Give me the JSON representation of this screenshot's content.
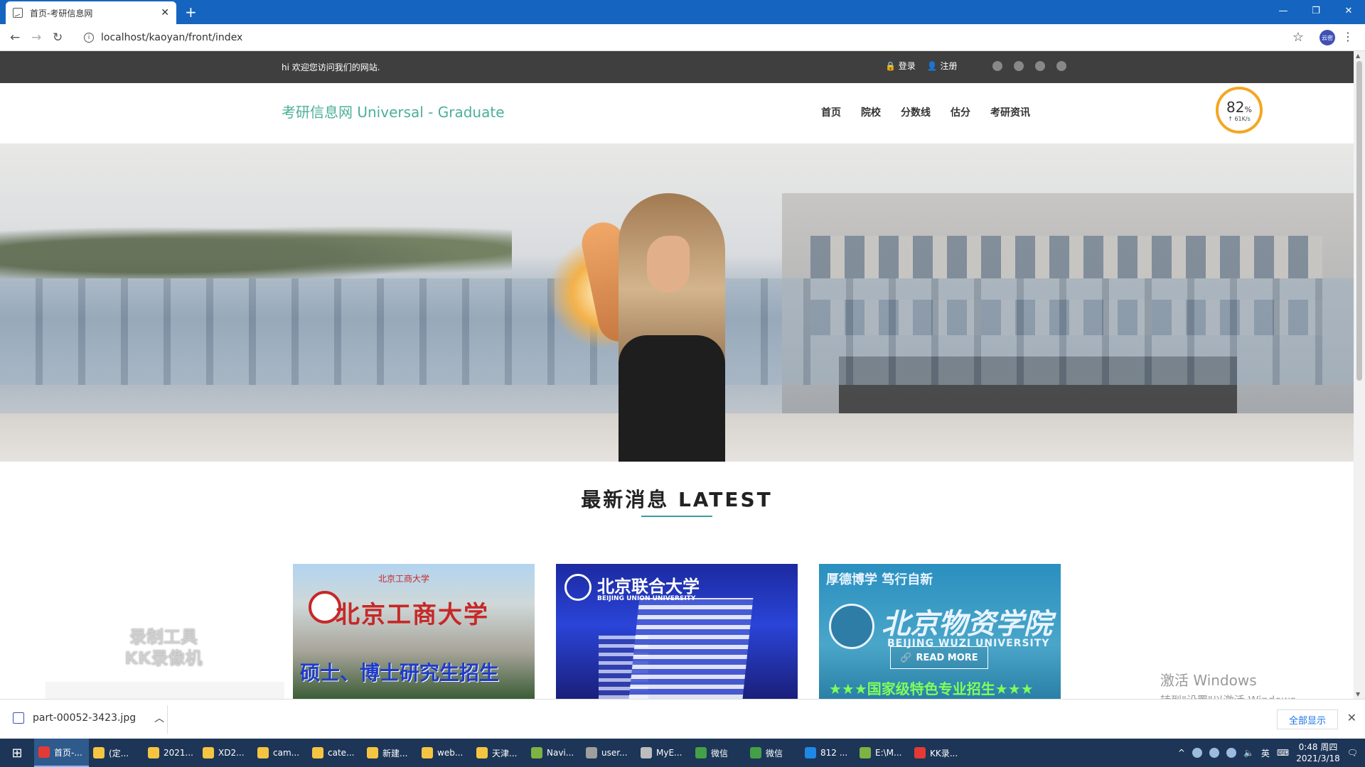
{
  "browser": {
    "tab_title": "首页-考研信息网",
    "url": "localhost/kaoyan/front/index",
    "profile_label": "云密"
  },
  "topbar": {
    "welcome": "hi 欢迎您访问我们的网站.",
    "login": "登录",
    "register": "注册"
  },
  "header": {
    "logo": "考研信息网 Universal - Graduate",
    "nav": [
      "首页",
      "院校",
      "分数线",
      "估分",
      "考研资讯"
    ]
  },
  "speed_widget": {
    "percent": "82",
    "unit": "%",
    "rate": "61K/s"
  },
  "section": {
    "title": "最新消息 LATEST"
  },
  "cards": [
    {
      "small_text": "北京工商大学",
      "name_cn": "北京工商大学",
      "caption": "硕士、博士研究生招生"
    },
    {
      "name_cn": "北京联合大学",
      "name_en": "BEIJING UNION UNIVERSITY"
    },
    {
      "motto": "厚德博学  笃行自新",
      "name_cn": "北京物资学院",
      "name_en": "BEIJING WUZI UNIVERSITY",
      "read_more": "READ MORE",
      "bottom": "★★★国家级特色专业招生★★★"
    }
  ],
  "overlay": {
    "recorder_watermark": "录制工具 KK录像机",
    "activate_windows": "激活 Windows",
    "activate_windows_sub": "转到\"设置\"以激活 Windows。"
  },
  "download_bar": {
    "file": "part-00052-3423.jpg",
    "show_all": "全部显示"
  },
  "taskbar": {
    "items": [
      {
        "label": "首页-...",
        "color": "#e53935"
      },
      {
        "label": "(定...",
        "color": "#f5c542"
      },
      {
        "label": "2021...",
        "color": "#f5c542"
      },
      {
        "label": "XD2...",
        "color": "#f5c542"
      },
      {
        "label": "cam...",
        "color": "#f5c542"
      },
      {
        "label": "cate...",
        "color": "#f5c542"
      },
      {
        "label": "新建...",
        "color": "#f5c542"
      },
      {
        "label": "web...",
        "color": "#f5c542"
      },
      {
        "label": "天津...",
        "color": "#f5c542"
      },
      {
        "label": "Navi...",
        "color": "#7cb342"
      },
      {
        "label": "user...",
        "color": "#9e9e9e"
      },
      {
        "label": "MyE...",
        "color": "#bdbdbd"
      },
      {
        "label": "微信",
        "color": "#43a047"
      },
      {
        "label": "微信",
        "color": "#43a047"
      },
      {
        "label": "812 ...",
        "color": "#1e88e5"
      },
      {
        "label": "E:\\M...",
        "color": "#7cb342"
      },
      {
        "label": "KK录...",
        "color": "#e53935"
      }
    ],
    "ime": "英",
    "time": "0:48 周四",
    "date": "2021/3/18"
  }
}
